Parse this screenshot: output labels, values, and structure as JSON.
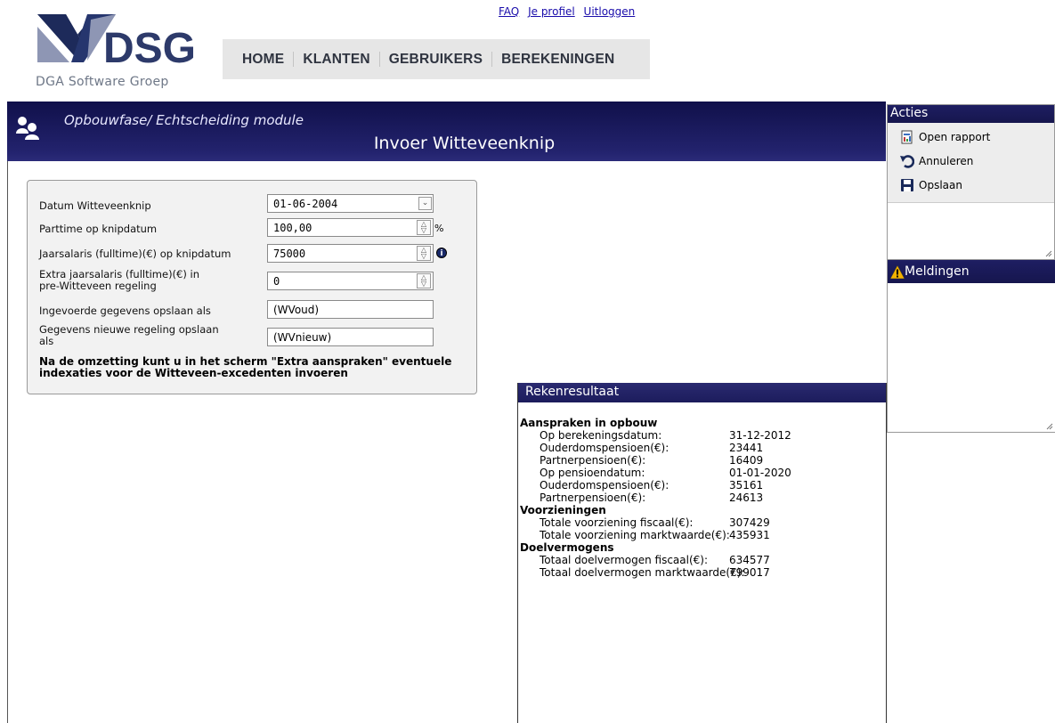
{
  "brand": {
    "logo_text": "DSG",
    "tagline": "DGA Software Groep"
  },
  "toplinks": [
    "FAQ",
    "Je profiel",
    "Uitloggen"
  ],
  "nav": [
    "HOME",
    "KLANTEN",
    "GEBRUIKERS",
    "BEREKENINGEN"
  ],
  "header": {
    "module": "Opbouwfase/ Echtscheiding module",
    "title": "Invoer Witteveenknip"
  },
  "form": {
    "datum_label": "Datum Witteveenknip",
    "datum_value": "01-06-2004",
    "parttime_label": "Parttime op knipdatum",
    "parttime_value": "100,00",
    "parttime_unit": "%",
    "jaarsalaris_label": "Jaarsalaris (fulltime)(€) op knipdatum",
    "jaarsalaris_value": "75000",
    "extra_label_1": "Extra jaarsalaris (fulltime)(€) in",
    "extra_label_2": "pre-Witteveen regeling",
    "extra_value": "0",
    "oud_label": "Ingevoerde gegevens opslaan als",
    "oud_value": "(WVoud)",
    "nieuw_label_1": "Gegevens nieuwe regeling opslaan",
    "nieuw_label_2": "als",
    "nieuw_value": "(WVnieuw)",
    "note": "Na de omzetting kunt u in het scherm \"Extra aanspraken\" eventuele indexaties voor de Witteveen-excedenten invoeren"
  },
  "result": {
    "title": "Rekenresultaat",
    "lines": [
      {
        "type": "section",
        "label": "Aanspraken in opbouw",
        "value": ""
      },
      {
        "type": "item",
        "label": "Op berekeningsdatum:",
        "value": "31-12-2012"
      },
      {
        "type": "item",
        "label": "Ouderdomspensioen(€):",
        "value": "23441"
      },
      {
        "type": "item",
        "label": "Partnerpensioen(€):",
        "value": "16409"
      },
      {
        "type": "item",
        "label": "Op pensioendatum:",
        "value": "01-01-2020"
      },
      {
        "type": "item",
        "label": "Ouderdomspensioen(€):",
        "value": "35161"
      },
      {
        "type": "item",
        "label": "Partnerpensioen(€):",
        "value": "24613"
      },
      {
        "type": "section",
        "label": "Voorzieningen",
        "value": ""
      },
      {
        "type": "item",
        "label": "Totale voorziening fiscaal(€):",
        "value": "307429"
      },
      {
        "type": "item",
        "label": "Totale voorziening marktwaarde(€):",
        "value": "435931"
      },
      {
        "type": "section",
        "label": "Doelvermogens",
        "value": ""
      },
      {
        "type": "item",
        "label": "Totaal doelvermogen fiscaal(€):",
        "value": "634577"
      },
      {
        "type": "item",
        "label": "Totaal doelvermogen marktwaarde(€):",
        "value": "799017"
      }
    ]
  },
  "acties": {
    "title": "Acties",
    "items": [
      {
        "label": "Open rapport",
        "icon": "report-icon"
      },
      {
        "label": "Annuleren",
        "icon": "undo-icon"
      },
      {
        "label": "Opslaan",
        "icon": "save-icon"
      }
    ]
  },
  "meldingen": {
    "title": "Meldingen"
  },
  "colors": {
    "header_navy": "#1c1c5c",
    "panel_gray": "#f2f2f2",
    "link": "#1a0dab"
  }
}
